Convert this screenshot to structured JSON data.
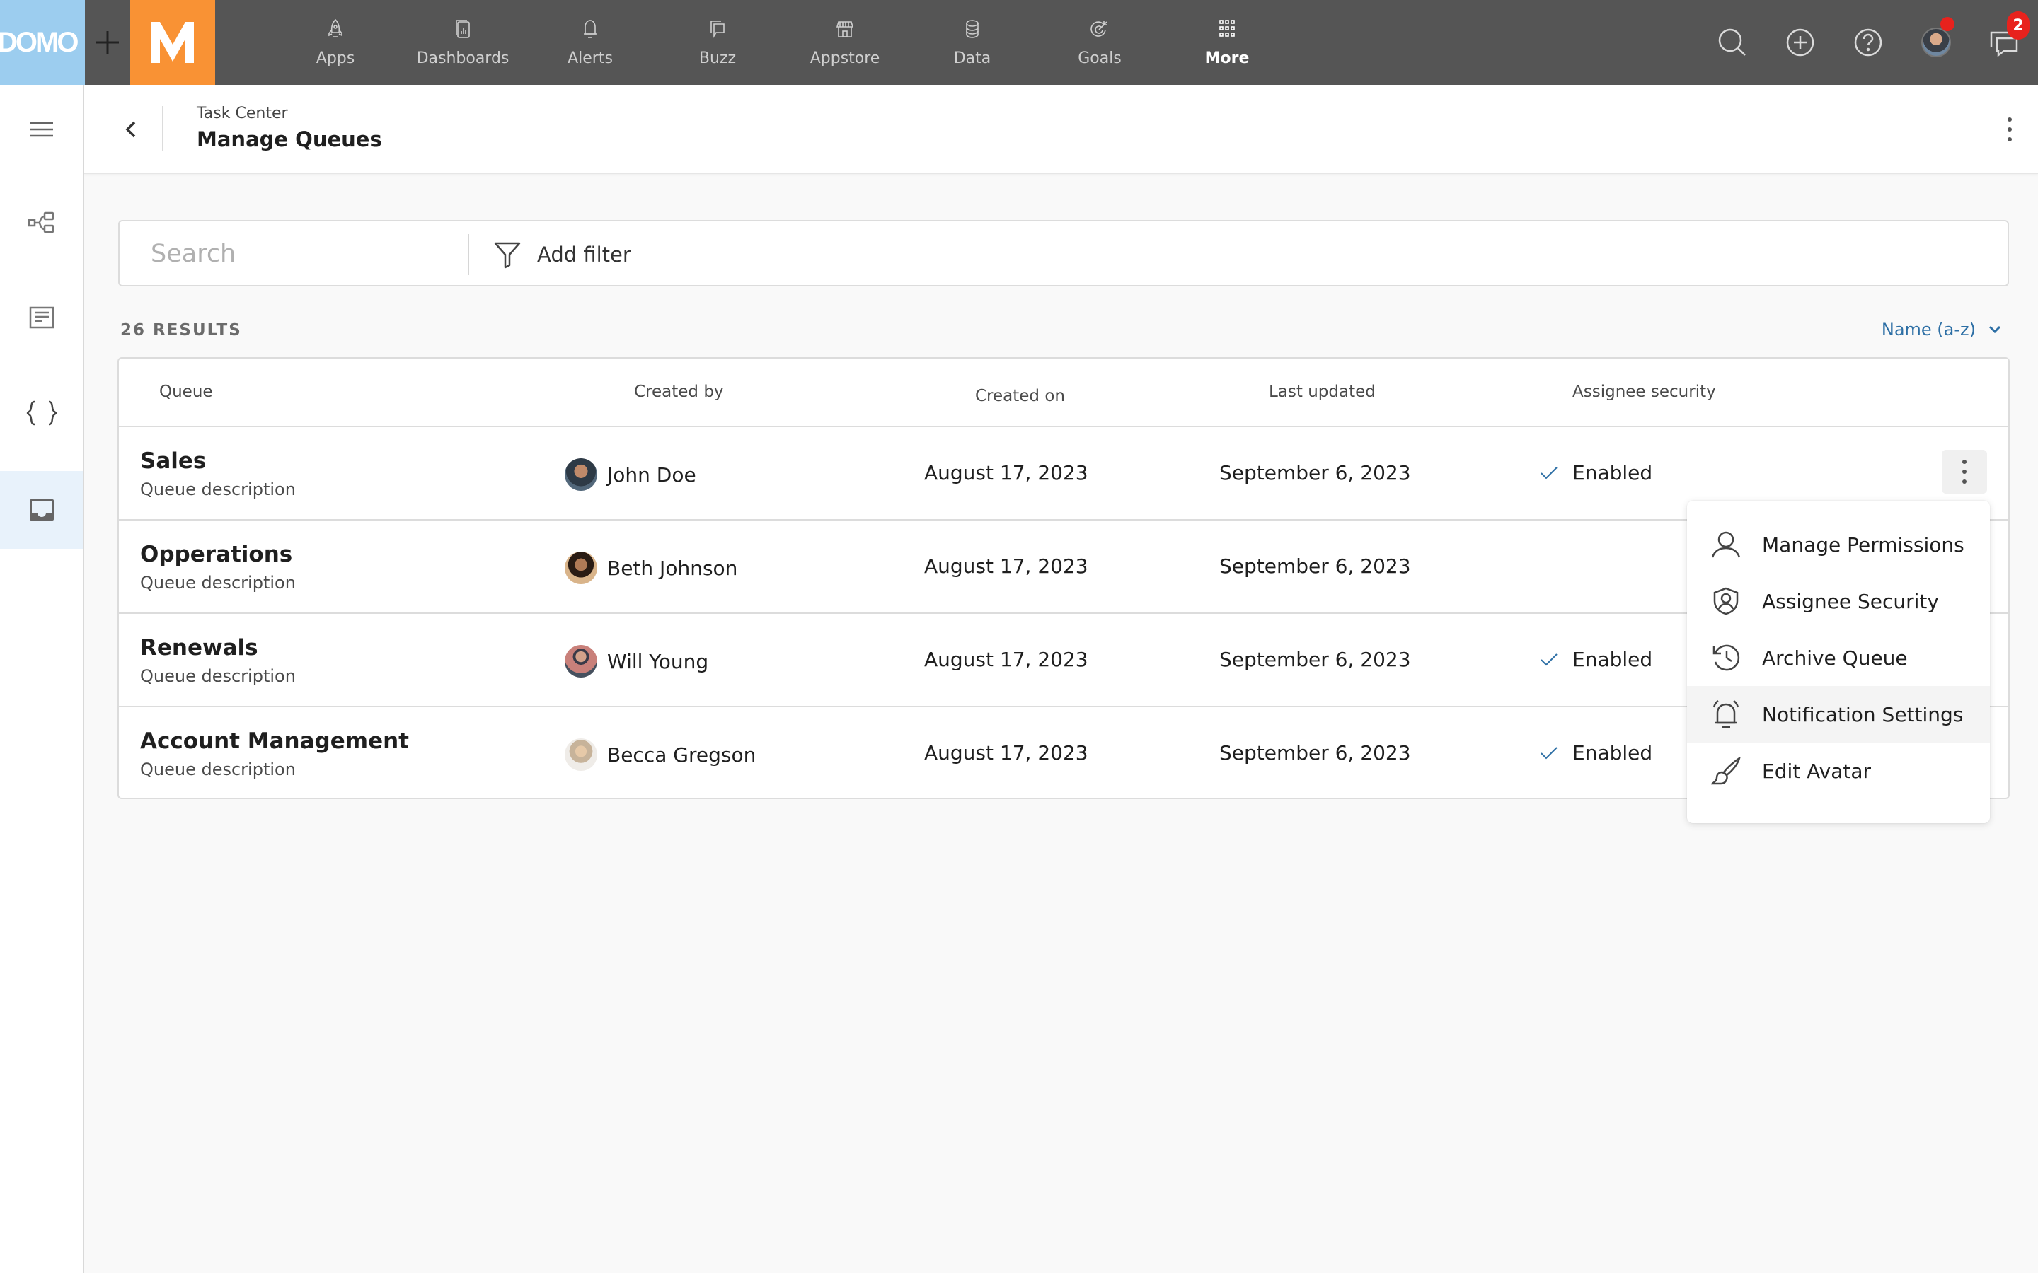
{
  "topbar": {
    "logo_text": "DOMO",
    "brand_letter": "M",
    "nav": [
      {
        "label": "Apps",
        "icon": "rocket-icon"
      },
      {
        "label": "Dashboards",
        "icon": "dashboard-icon"
      },
      {
        "label": "Alerts",
        "icon": "bell-icon"
      },
      {
        "label": "Buzz",
        "icon": "chat-bubbles-icon"
      },
      {
        "label": "Appstore",
        "icon": "store-icon"
      },
      {
        "label": "Data",
        "icon": "database-icon"
      },
      {
        "label": "Goals",
        "icon": "target-icon"
      },
      {
        "label": "More",
        "icon": "grid-icon",
        "active": true
      }
    ],
    "right_icons": [
      "search-icon",
      "add-circle-icon",
      "help-icon",
      "user-avatar",
      "messages-icon"
    ],
    "messages_badge": "2"
  },
  "sidebar": {
    "items": [
      {
        "icon": "hamburger-menu-icon"
      },
      {
        "icon": "workflow-icon"
      },
      {
        "icon": "document-icon"
      },
      {
        "icon": "code-braces-icon"
      },
      {
        "icon": "inbox-icon",
        "active": true
      }
    ]
  },
  "header": {
    "breadcrumb": "Task Center",
    "title": "Manage Queues"
  },
  "search": {
    "placeholder": "Search",
    "value": "",
    "add_filter_label": "Add filter"
  },
  "results": {
    "count_label": "26 RESULTS",
    "sort_label": "Name (a-z)"
  },
  "table": {
    "columns": [
      "Queue",
      "Created by",
      "Created on",
      "Last updated",
      "Assignee security"
    ],
    "rows": [
      {
        "name": "Sales",
        "description": "Queue description",
        "created_by": "John Doe",
        "created_on": "August 17, 2023",
        "last_updated": "September 6, 2023",
        "assignee_security": "Enabled"
      },
      {
        "name": "Opperations",
        "description": "Queue description",
        "created_by": "Beth Johnson",
        "created_on": "August 17, 2023",
        "last_updated": "September 6, 2023",
        "assignee_security": ""
      },
      {
        "name": "Renewals",
        "description": "Queue description",
        "created_by": "Will Young",
        "created_on": "August 17, 2023",
        "last_updated": "September 6, 2023",
        "assignee_security": "Enabled"
      },
      {
        "name": "Account Management",
        "description": "Queue description",
        "created_by": "Becca Gregson",
        "created_on": "August 17, 2023",
        "last_updated": "September 6, 2023",
        "assignee_security": "Enabled"
      }
    ]
  },
  "menu": {
    "items": [
      {
        "label": "Manage Permissions",
        "icon": "user-icon"
      },
      {
        "label": "Assignee Security",
        "icon": "shield-user-icon"
      },
      {
        "label": "Archive Queue",
        "icon": "history-icon"
      },
      {
        "label": "Notification Settings",
        "icon": "alarm-bell-icon",
        "hover": true
      },
      {
        "label": "Edit Avatar",
        "icon": "paintbrush-icon"
      }
    ]
  },
  "colors": {
    "topbar": "#555555",
    "domo_blue": "#9ccdef",
    "brand_orange": "#f99234",
    "link_blue": "#2d6fa5",
    "badge_red": "#e8221d",
    "active_sidebar": "#e8f2fb"
  }
}
